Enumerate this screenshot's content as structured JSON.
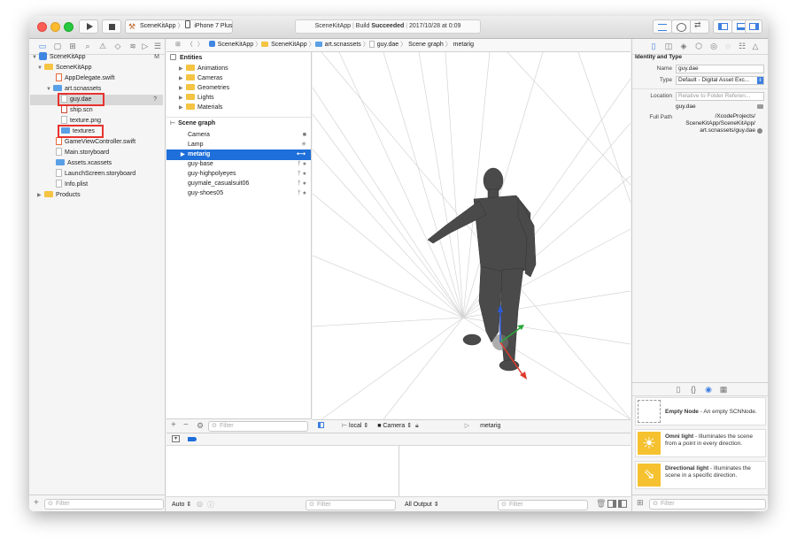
{
  "toolbar": {
    "scheme": "SceneKitApp",
    "device": "iPhone 7 Plus",
    "activity_app": "SceneKitApp",
    "activity_status_prefix": "Build ",
    "activity_status": "Succeeded",
    "activity_time": "2017/10/28 at 0:09"
  },
  "navigator": {
    "project": "SceneKitApp",
    "project_badge": "M",
    "group": "SceneKitApp",
    "items": [
      {
        "label": "AppDelegate.swift"
      },
      {
        "label": "art.scnassets"
      },
      {
        "label": "guy.dae",
        "badge": "?"
      },
      {
        "label": "ship.scn"
      },
      {
        "label": "texture.png"
      },
      {
        "label": "textures"
      },
      {
        "label": "GameViewController.swift"
      },
      {
        "label": "Main.storyboard"
      },
      {
        "label": "Assets.xcassets"
      },
      {
        "label": "LaunchScreen.storyboard"
      },
      {
        "label": "Info.plist"
      },
      {
        "label": "Products"
      }
    ],
    "filter_placeholder": "Filter"
  },
  "jumpbar": [
    "SceneKitApp",
    "SceneKitApp",
    "art.scnassets",
    "guy.dae",
    "Scene graph",
    "metarig"
  ],
  "outline": {
    "entities_title": "Entities",
    "entities": [
      "Animations",
      "Cameras",
      "Geometries",
      "Lights",
      "Materials"
    ],
    "scene_graph_title": "Scene graph",
    "nodes": [
      "Camera",
      "Lamp",
      "metarig",
      "guy-base",
      "guy-highpolyeyes",
      "guymale_casualsuit06",
      "guy-shoes05"
    ],
    "filter_placeholder": "Filter"
  },
  "viewport_bar": {
    "space": "local",
    "camera": "Camera",
    "node": "metarig"
  },
  "debug": {
    "auto": "Auto",
    "filter_placeholder": "Filter",
    "output": "All Output",
    "filter2_placeholder": "Filter"
  },
  "inspector": {
    "section_title": "Identity and Type",
    "name_label": "Name",
    "name_value": "guy.dae",
    "type_label": "Type",
    "type_value": "Default - Digital Asset Exc...",
    "location_label": "Location",
    "location_value": "Relative to Folder Referen...",
    "location_file": "guy.dae",
    "fullpath_label": "Full Path",
    "fullpath_value": "/XcodeProjects/ SceneKitApp/SceneKitApp/ art.scnassets/guy.dae",
    "library": [
      {
        "title": "Empty Node",
        "desc": " - An empty SCNNode."
      },
      {
        "title": "Omni light",
        "desc": " - Illuminates the scene from a point in every direction."
      },
      {
        "title": "Directional light",
        "desc": " - Illuminates the scene in a specific direction."
      }
    ],
    "filter_placeholder": "Filter"
  },
  "colors": {
    "selection": "#1e6fd9",
    "folder": "#f5c443",
    "highlight_box": "#e8322e",
    "light_icon": "#f6c12f"
  }
}
